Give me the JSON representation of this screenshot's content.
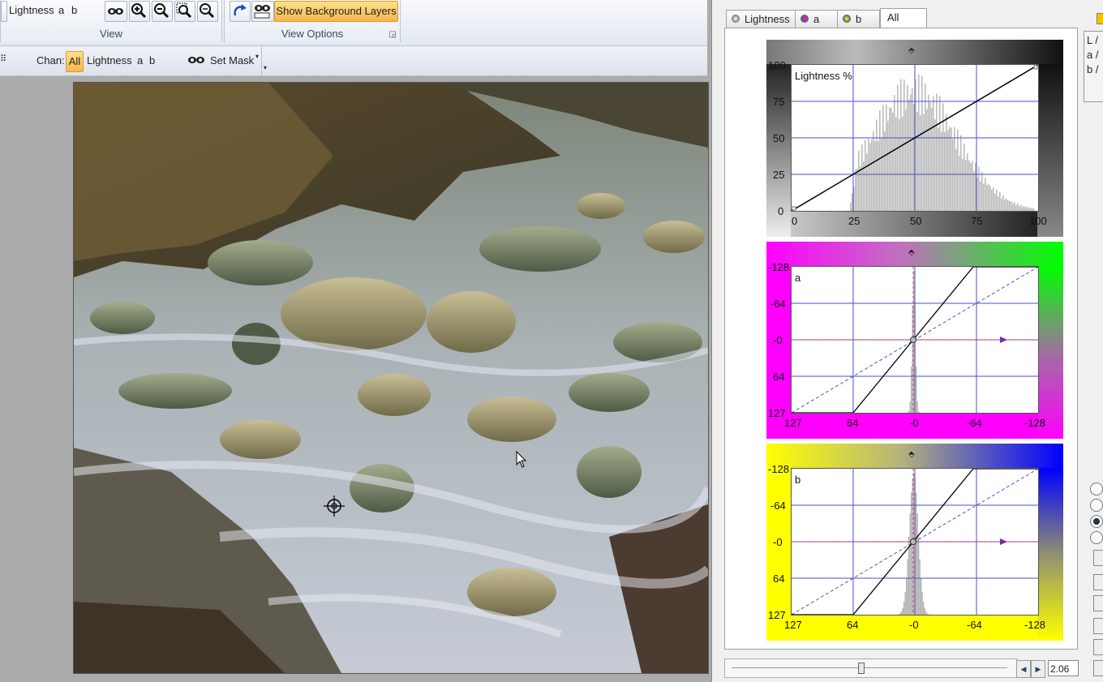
{
  "ribbon": {
    "view_group": {
      "title": "View",
      "channel_items": [
        "Lightness",
        "a",
        "b"
      ]
    },
    "view_options_group": {
      "title": "View Options",
      "show_bg_label": "Show Background Layers"
    }
  },
  "toolbar": {
    "chan_label": "Chan:",
    "all_label": "All",
    "lightness_label": "Lightness",
    "a_label": "a",
    "b_label": "b",
    "set_mask_label": "Set Mask"
  },
  "panel": {
    "tabs": [
      "Lightness",
      "a",
      "b",
      "All"
    ],
    "active_tab": "All",
    "side_labels": [
      "L /",
      "a /",
      "b /"
    ],
    "slider_value": "2.06",
    "slider_position": 0.46
  },
  "curves": {
    "lightness": {
      "label": "Lightness %",
      "y_ticks": [
        "100",
        "75",
        "50",
        "25",
        "0"
      ],
      "x_ticks": [
        "0",
        "25",
        "50",
        "75",
        "100"
      ]
    },
    "a": {
      "label": "a",
      "y_ticks": [
        "-128",
        "-64",
        "-0",
        "64",
        "127"
      ],
      "x_ticks": [
        "127",
        "64",
        "-0",
        "-64",
        "-128"
      ]
    },
    "b": {
      "label": "b",
      "y_ticks": [
        "-128",
        "-64",
        "-0",
        "64",
        "127"
      ],
      "x_ticks": [
        "127",
        "64",
        "-0",
        "-64",
        "-128"
      ]
    }
  },
  "colors": {
    "highlight": "#f6b64a",
    "grid_line": "#4a52c8",
    "a_gradient_left": "#ff00ff",
    "a_gradient_right": "#00ff00",
    "b_gradient_left": "#ffff00",
    "b_gradient_right": "#0000ff"
  }
}
